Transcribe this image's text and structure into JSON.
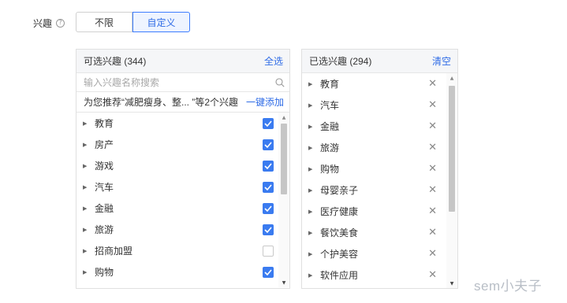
{
  "filter": {
    "label": "兴趣",
    "help_icon": "?",
    "options": [
      "不限",
      "自定义"
    ],
    "selected": "自定义"
  },
  "left_panel": {
    "title": "可选兴趣 (344)",
    "action": "全选",
    "search_placeholder": "输入兴趣名称搜索",
    "recommend_text": "为您推荐“减肥瘦身、整... ”等2个兴趣",
    "recommend_action": "一键添加",
    "items": [
      {
        "label": "教育",
        "checked": true
      },
      {
        "label": "房产",
        "checked": true
      },
      {
        "label": "游戏",
        "checked": true
      },
      {
        "label": "汽车",
        "checked": true
      },
      {
        "label": "金融",
        "checked": true
      },
      {
        "label": "旅游",
        "checked": true
      },
      {
        "label": "招商加盟",
        "checked": false
      },
      {
        "label": "购物",
        "checked": true
      }
    ]
  },
  "right_panel": {
    "title": "已选兴趣 (294)",
    "action": "清空",
    "items": [
      {
        "label": "教育"
      },
      {
        "label": "汽车"
      },
      {
        "label": "金融"
      },
      {
        "label": "旅游"
      },
      {
        "label": "购物"
      },
      {
        "label": "母婴亲子"
      },
      {
        "label": "医疗健康"
      },
      {
        "label": "餐饮美食"
      },
      {
        "label": "个护美容"
      },
      {
        "label": "软件应用"
      }
    ]
  },
  "watermark": "sem小夫子",
  "colors": {
    "accent": "#2e6be6",
    "checkbox": "#3a7bf0",
    "border": "#e0e0e0",
    "header_bg": "#f5f6f8"
  }
}
